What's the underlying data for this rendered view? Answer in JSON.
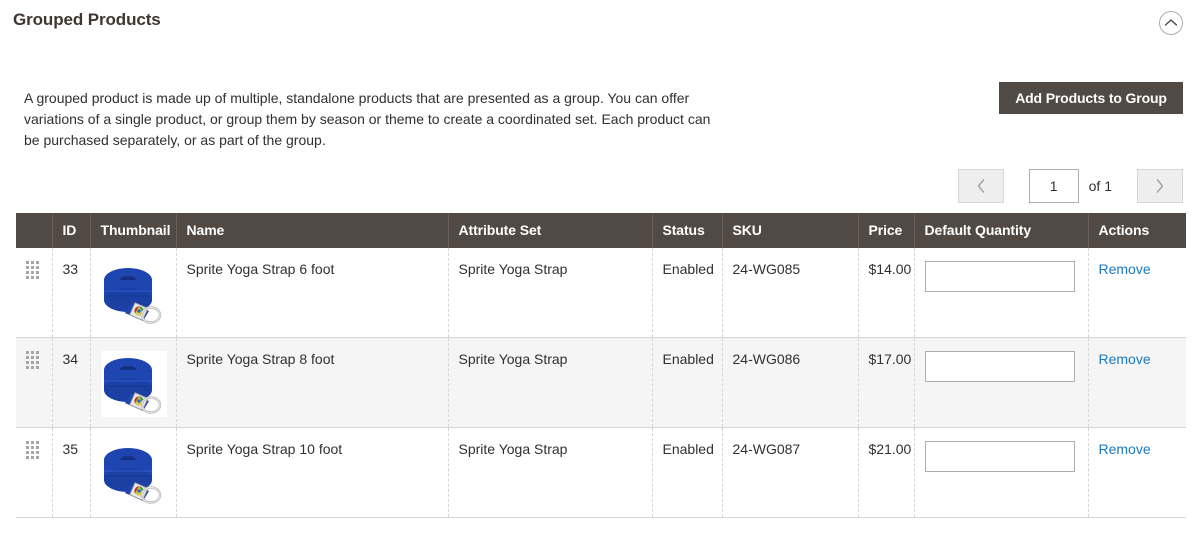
{
  "section": {
    "title": "Grouped Products",
    "collapse_icon": "chevron-up-circle-icon"
  },
  "intro": {
    "description": "A grouped product is made up of multiple, standalone products that are presented as a group. You can offer variations of a single product, or group them by season or theme to create a coordinated set. Each product can be purchased separately, or as part of the group.",
    "add_button_label": "Add Products to Group"
  },
  "pager": {
    "previous_icon": "chevron-left-icon",
    "next_icon": "chevron-right-icon",
    "current_page": "1",
    "of_total_label": "of 1"
  },
  "table": {
    "columns": [
      {
        "key": "handle",
        "label": ""
      },
      {
        "key": "id",
        "label": "ID"
      },
      {
        "key": "thumbnail",
        "label": "Thumbnail"
      },
      {
        "key": "name",
        "label": "Name"
      },
      {
        "key": "attribute_set",
        "label": "Attribute Set"
      },
      {
        "key": "status",
        "label": "Status"
      },
      {
        "key": "sku",
        "label": "SKU"
      },
      {
        "key": "price",
        "label": "Price"
      },
      {
        "key": "default_quantity",
        "label": "Default Quantity"
      },
      {
        "key": "actions",
        "label": "Actions"
      }
    ],
    "rows": [
      {
        "id": "33",
        "thumbnail_alt": "blue-yoga-strap-thumbnail",
        "name": "Sprite Yoga Strap 6 foot",
        "attribute_set": "Sprite Yoga Strap",
        "status": "Enabled",
        "sku": "24-WG085",
        "price": "$14.00",
        "default_quantity": "",
        "default_quantity_placeholder": "",
        "action_label": "Remove"
      },
      {
        "id": "34",
        "thumbnail_alt": "blue-yoga-strap-thumbnail",
        "name": "Sprite Yoga Strap 8 foot",
        "attribute_set": "Sprite Yoga Strap",
        "status": "Enabled",
        "sku": "24-WG086",
        "price": "$17.00",
        "default_quantity": "",
        "default_quantity_placeholder": "",
        "action_label": "Remove"
      },
      {
        "id": "35",
        "thumbnail_alt": "blue-yoga-strap-thumbnail",
        "name": "Sprite Yoga Strap 10 foot",
        "attribute_set": "Sprite Yoga Strap",
        "status": "Enabled",
        "sku": "24-WG087",
        "price": "$21.00",
        "default_quantity": "",
        "default_quantity_placeholder": "",
        "action_label": "Remove"
      }
    ]
  },
  "colors": {
    "header_bar": "#514943",
    "primary_button": "#514943",
    "link": "#1979c3",
    "text": "#303030",
    "row_alt": "#f5f5f5",
    "border": "#d6d6d6",
    "thumbnail_blue": "#1e45b0"
  }
}
